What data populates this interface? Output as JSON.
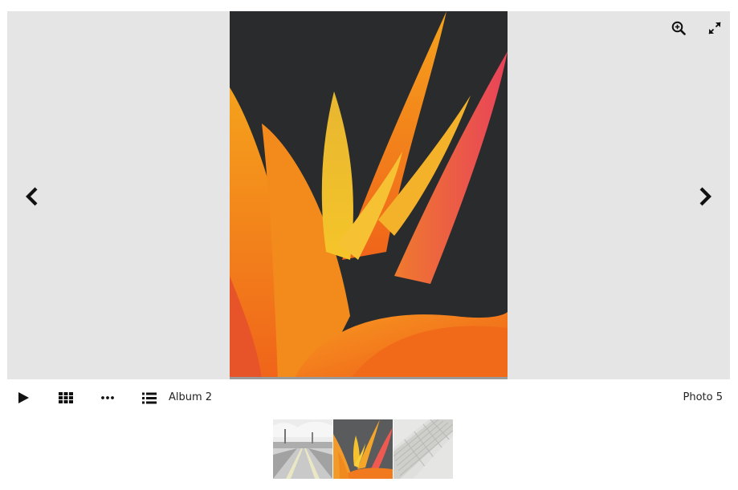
{
  "viewer": {
    "album_title": "Album 2",
    "photo_counter": "Photo 5",
    "slideshow_progress": 0.0
  },
  "controls": {
    "zoom_icon": "zoom-in-icon",
    "fullscreen_icon": "expand-icon",
    "prev_icon": "chevron-left-icon",
    "next_icon": "chevron-right-icon",
    "play_icon": "play-icon",
    "grid_icon": "grid-icon",
    "more_icon": "ellipsis-icon",
    "list_icon": "list-icon"
  },
  "thumbnails": [
    {
      "subject": "grey-road-landscape",
      "active": false
    },
    {
      "subject": "orange-flower",
      "active": true
    },
    {
      "subject": "grey-roof-tiles",
      "active": false
    }
  ],
  "colors": {
    "stage_background": "#e5e5e5",
    "photo_background": "#2a2b2c",
    "icon": "#111111"
  }
}
